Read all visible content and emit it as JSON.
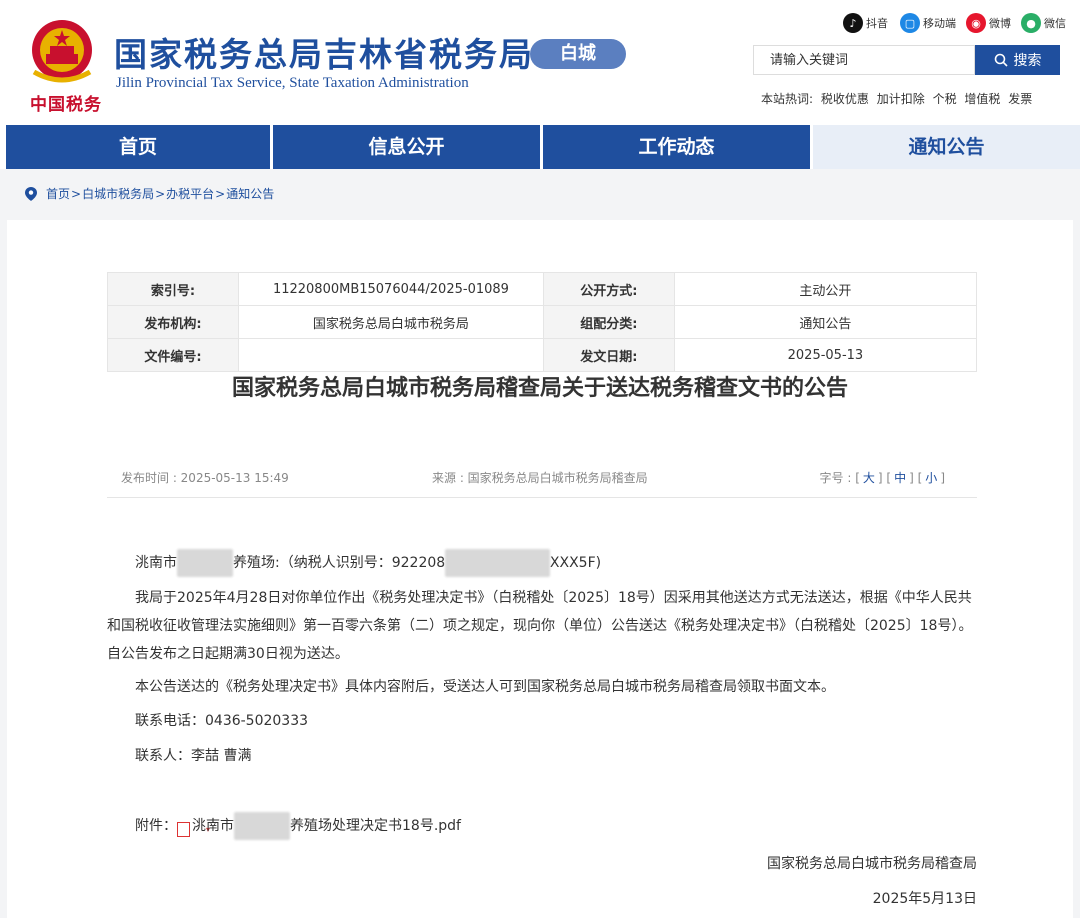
{
  "header": {
    "logo_script": "中国税务",
    "title_cn": "国家税务总局吉林省税务局",
    "title_en": "Jilin Provincial Tax Service, State Taxation Administration",
    "city_badge": "白城",
    "brand_color": "#1f4f9e"
  },
  "social": [
    {
      "label": "抖音",
      "icon": "douyin-icon",
      "color": "#111111"
    },
    {
      "label": "移动端",
      "icon": "mobile-icon",
      "color": "#1e88e5"
    },
    {
      "label": "微博",
      "icon": "weibo-icon",
      "color": "#e6162d"
    },
    {
      "label": "微信",
      "icon": "wechat-icon",
      "color": "#2aae67"
    }
  ],
  "search": {
    "placeholder": "请输入关键词",
    "button_label": "搜索",
    "hot_label": "本站热词:",
    "hot_words": [
      "税收优惠",
      "加计扣除",
      "个税",
      "增值税",
      "发票"
    ]
  },
  "nav": [
    {
      "label": "首页",
      "active": false
    },
    {
      "label": "信息公开",
      "active": false
    },
    {
      "label": "工作动态",
      "active": false
    },
    {
      "label": "通知公告",
      "active": true
    }
  ],
  "breadcrumb": [
    "首页",
    "白城市税务局",
    "办税平台",
    "通知公告"
  ],
  "meta": {
    "index_key": "索引号:",
    "index_val": "11220800MB15076044/2025-01089",
    "disclose_key": "公开方式:",
    "disclose_val": "主动公开",
    "org_key": "发布机构:",
    "org_val": "国家税务总局白城市税务局",
    "cat_key": "组配分类:",
    "cat_val": "通知公告",
    "docno_key": "文件编号:",
    "docno_val": "",
    "date_key": "发文日期:",
    "date_val": "2025-05-13"
  },
  "article": {
    "title": "国家税务总局白城市税务局稽查局关于送达税务稽查文书的公告",
    "publish_time": "发布时间 : 2025-05-13 15:49",
    "source": "来源 : 国家税务总局白城市税务局稽查局",
    "font_size_label": "字号 :",
    "font_sizes": [
      "大",
      "中",
      "小"
    ],
    "addressee_a": "洮南市",
    "addressee_b": "养殖场:（纳税人识别号：922208",
    "addressee_c": "XXX5F)",
    "p1": "我局于2025年4月28日对你单位作出《税务处理决定书》（白税稽处〔2025〕18号）因采用其他送达方式无法送达，根据《中华人民共和国税收征收管理法实施细则》第一百零六条第（二）项之规定，现向你（单位）公告送达《税务处理决定书》（白税稽处〔2025〕18号）。自公告发布之日起期满30日视为送达。",
    "p2": "本公告送达的《税务处理决定书》具体内容附后，受送达人可到国家税务总局白城市税务局稽查局领取书面文本。",
    "phone": "联系电话：0436-5020333",
    "contact": "联系人：李喆  曹满",
    "attach_label": "附件：",
    "attach_a": "洮南市",
    "attach_b": "养殖场处理决定书18号.pdf",
    "sign_org": "国家税务总局白城市税务局稽查局",
    "sign_date": "2025年5月13日"
  }
}
